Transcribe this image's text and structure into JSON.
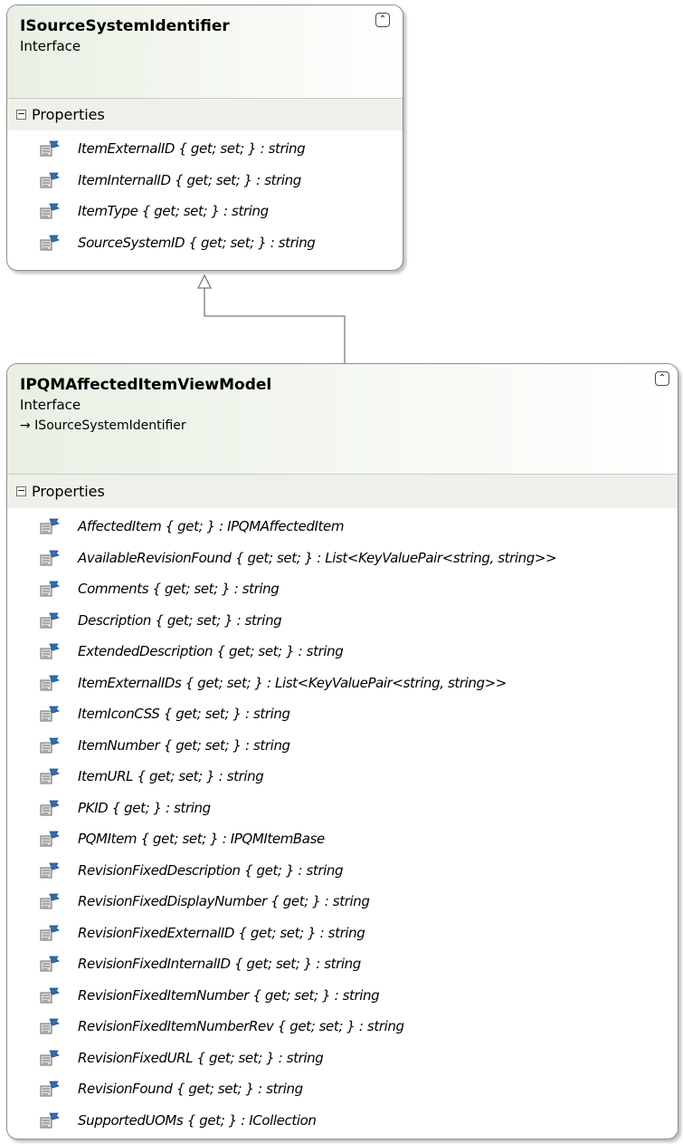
{
  "shapes": [
    {
      "name": "ISourceSystemIdentifier",
      "stereotype": "Interface",
      "section": "Properties",
      "members": [
        "ItemExternalID { get; set; } : string",
        "ItemInternalID { get; set; } : string",
        "ItemType { get; set; } : string",
        "SourceSystemID { get; set; } : string"
      ]
    },
    {
      "name": "IPQMAffectedItemViewModel",
      "stereotype": "Interface",
      "base": "→ ISourceSystemIdentifier",
      "section": "Properties",
      "members": [
        "AffectedItem { get; } : IPQMAffectedItem",
        "AvailableRevisionFound { get; set; } : List<KeyValuePair<string, string>>",
        "Comments { get; set; } : string",
        "Description { get; set; } : string",
        "ExtendedDescription { get; set; } : string",
        "ItemExternalIDs { get; set; } : List<KeyValuePair<string, string>>",
        "ItemIconCSS { get; set; } : string",
        "ItemNumber { get; set; } : string",
        "ItemURL { get; set; } : string",
        "PKID { get; } : string",
        "PQMItem { get; set; } : IPQMItemBase",
        "RevisionFixedDescription { get; } : string",
        "RevisionFixedDisplayNumber { get; } : string",
        "RevisionFixedExternalID { get; set; } : string",
        "RevisionFixedInternalID { get; set; } : string",
        "RevisionFixedItemNumber { get; set; } : string",
        "RevisionFixedItemNumberRev { get; set; } : string",
        "RevisionFixedURL { get; set; } : string",
        "RevisionFound { get; set; } : string",
        "SupportedUOMs { get; } : ICollection"
      ]
    }
  ],
  "icons": {
    "collapse": "double-chevron-up-icon",
    "expander": "minus-box-icon",
    "member": "property-icon"
  },
  "colors": {
    "header_gradient": "#e9f0e3",
    "border": "#8f8f8f",
    "connector": "#7a7a7a"
  }
}
